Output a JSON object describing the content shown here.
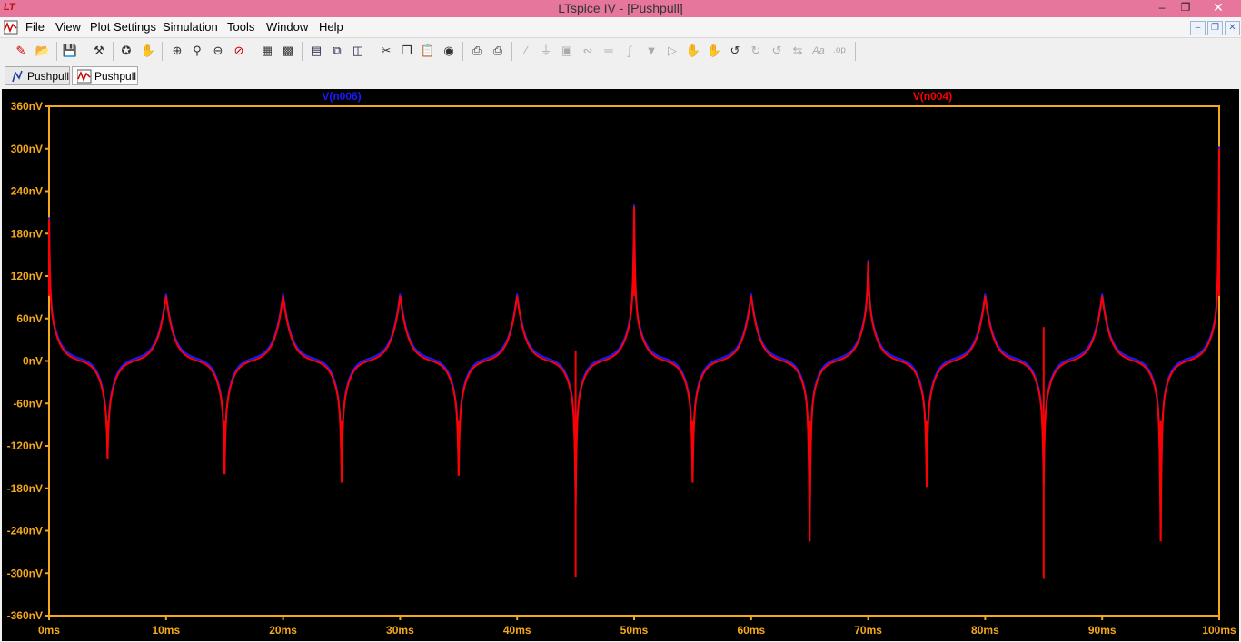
{
  "window": {
    "title": "LTspice IV - [Pushpull]"
  },
  "menu": {
    "items": [
      "File",
      "View",
      "Plot Settings",
      "Simulation",
      "Tools",
      "Window",
      "Help"
    ]
  },
  "tabs": [
    {
      "label": "Pushpull",
      "active": false
    },
    {
      "label": "Pushpull",
      "active": true
    }
  ],
  "colors": {
    "axis": "#f4a81c",
    "trace_blue": "#1a1aff",
    "trace_red": "#ff0000",
    "background": "#000000",
    "titlebar": "#e6769b"
  },
  "chart_data": {
    "type": "line",
    "title": "",
    "xlabel": "",
    "ylabel": "",
    "xlim": [
      0,
      100
    ],
    "ylim": [
      -360,
      360
    ],
    "x_unit": "ms",
    "y_unit": "nV",
    "x_ticks": [
      "0ms",
      "10ms",
      "20ms",
      "30ms",
      "40ms",
      "50ms",
      "60ms",
      "70ms",
      "80ms",
      "90ms",
      "100ms"
    ],
    "y_ticks": [
      "360nV",
      "300nV",
      "240nV",
      "180nV",
      "120nV",
      "60nV",
      "0nV",
      "-60nV",
      "-120nV",
      "-180nV",
      "-240nV",
      "-300nV",
      "-360nV"
    ],
    "series": [
      {
        "name": "V(n006)",
        "color": "#1a1aff"
      },
      {
        "name": "V(n004)",
        "color": "#ff0000"
      }
    ],
    "cycle": {
      "period_ms": 10,
      "peak_nV": 92,
      "trough_nV": -85,
      "peak_at_ms": [
        10,
        20,
        30,
        40,
        50,
        60,
        70,
        80,
        90
      ],
      "trough_at_ms": [
        5,
        15,
        25,
        35,
        45,
        55,
        65,
        75,
        85,
        95
      ]
    },
    "spikes": [
      {
        "x": 0,
        "y": 200
      },
      {
        "x": 5,
        "y": -138
      },
      {
        "x": 15,
        "y": -160
      },
      {
        "x": 25,
        "y": -172
      },
      {
        "x": 35,
        "y": -162
      },
      {
        "x": 45,
        "y": -305
      },
      {
        "x": 45,
        "y": 15
      },
      {
        "x": 50,
        "y": 218
      },
      {
        "x": 55,
        "y": -172
      },
      {
        "x": 65,
        "y": -255
      },
      {
        "x": 70,
        "y": 140
      },
      {
        "x": 75,
        "y": -178
      },
      {
        "x": 85,
        "y": -308
      },
      {
        "x": 85,
        "y": 48
      },
      {
        "x": 95,
        "y": -255
      },
      {
        "x": 100,
        "y": 300
      }
    ]
  }
}
